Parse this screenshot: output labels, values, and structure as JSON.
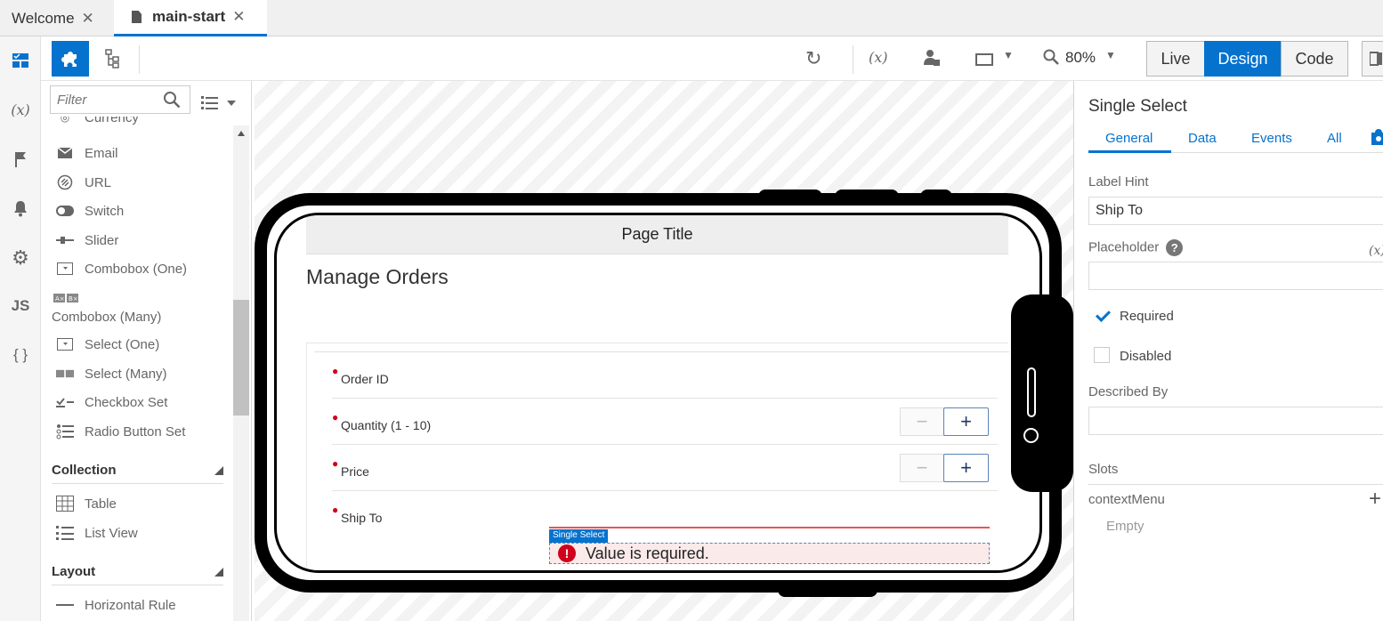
{
  "tabs": [
    {
      "label": "Welcome",
      "active": false
    },
    {
      "label": "main-start",
      "active": true
    }
  ],
  "rail": {
    "icons": [
      "components-icon",
      "variables-icon",
      "flag-icon",
      "bell-icon",
      "gear-icon",
      "js-icon",
      "json-icon"
    ],
    "variables_glyph": "(x)",
    "js_glyph": "JS",
    "json_glyph": "{ }"
  },
  "toolbar": {
    "zoom": "80%",
    "modes": [
      "Live",
      "Design",
      "Code"
    ],
    "active_mode": "Design"
  },
  "palette": {
    "filter_placeholder": "Filter",
    "cut_item": "Currency",
    "items": [
      "Email",
      "URL",
      "Switch",
      "Slider",
      "Combobox (One)"
    ],
    "combobox_many": "Combobox (Many)",
    "items2": [
      "Select (One)",
      "Select (Many)",
      "Checkbox Set",
      "Radio Button Set"
    ],
    "collection_header": "Collection",
    "collection_items": [
      "Table",
      "List View"
    ],
    "layout_header": "Layout",
    "layout_items": [
      "Horizontal Rule"
    ]
  },
  "phone": {
    "page_title": "Page Title",
    "heading": "Manage Orders",
    "fields": [
      {
        "label": "Order ID",
        "required": true,
        "stepper": false
      },
      {
        "label": "Quantity (1 - 10)",
        "required": true,
        "stepper": true
      },
      {
        "label": "Price",
        "required": true,
        "stepper": true
      },
      {
        "label": "Ship To",
        "required": true,
        "stepper": false
      }
    ],
    "minus": "−",
    "plus": "+",
    "select_tag": "Single Select",
    "error_icon": "!",
    "error_text": "Value is required."
  },
  "properties": {
    "title": "Single Select",
    "tabs": [
      "General",
      "Data",
      "Events",
      "All"
    ],
    "active_tab": "General",
    "label_hint_label": "Label Hint",
    "label_hint_value": "Ship To",
    "placeholder_label": "Placeholder",
    "placeholder_value": "",
    "help_glyph": "?",
    "expression_glyph": "(x)",
    "required_label": "Required",
    "required_checked": true,
    "disabled_label": "Disabled",
    "disabled_checked": false,
    "described_by_label": "Described By",
    "described_by_value": "",
    "slots_label": "Slots",
    "slot_name": "contextMenu",
    "slot_empty": "Empty",
    "add_glyph": "+"
  },
  "colors": {
    "accent": "#0572ce",
    "error": "#d0021b",
    "required_dot": "#d0021b"
  }
}
